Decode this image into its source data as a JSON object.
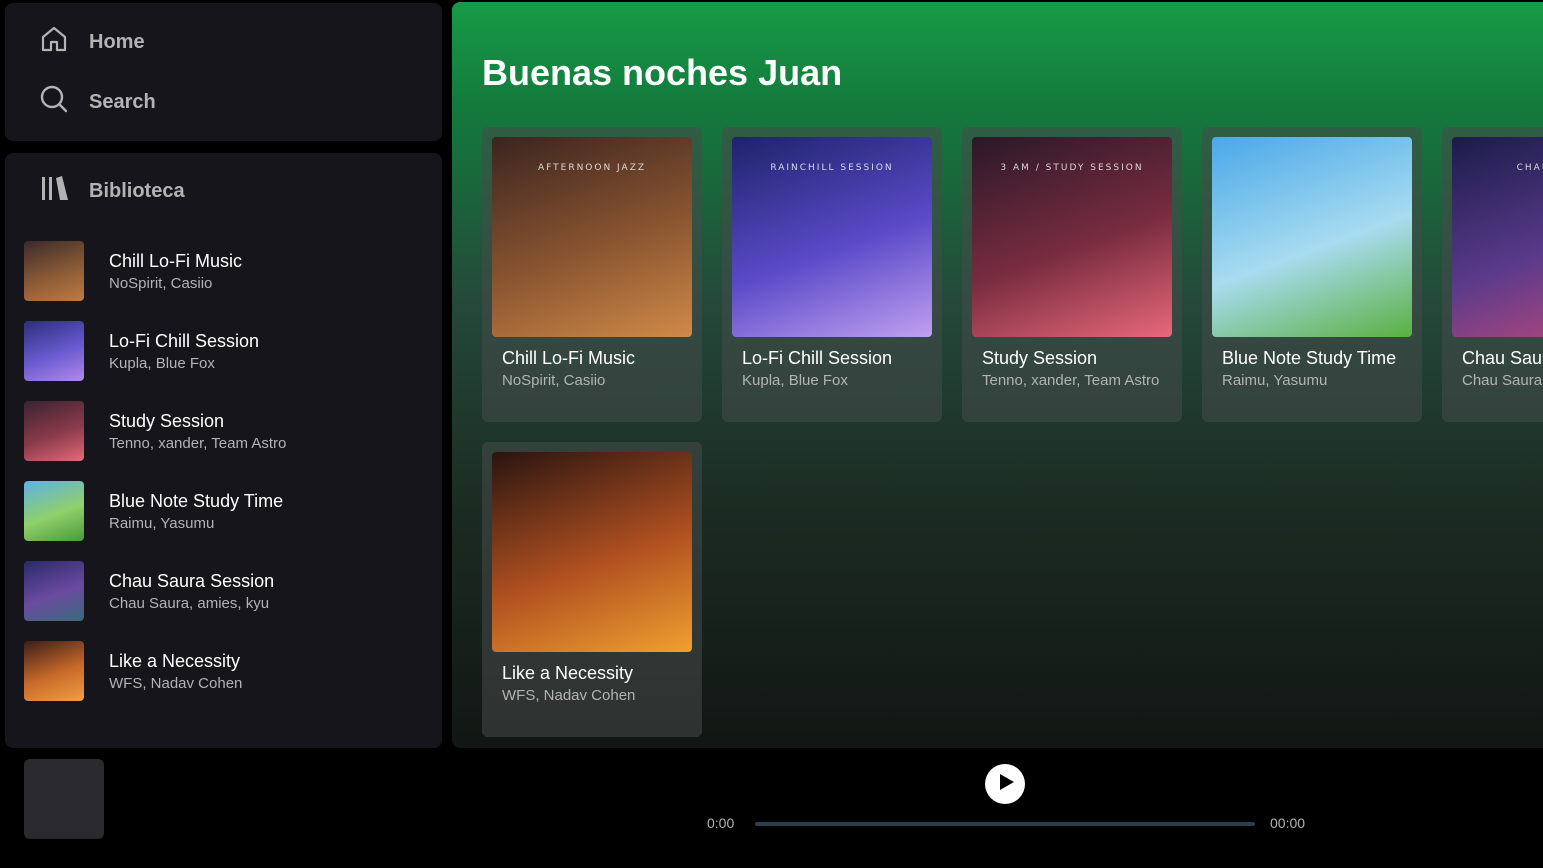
{
  "nav": {
    "home_label": "Home",
    "search_label": "Search"
  },
  "library": {
    "title": "Biblioteca",
    "items": [
      {
        "title": "Chill Lo-Fi Music",
        "artists": "NoSpirit, Casiio",
        "thumb_colors": [
          "#3b2a2a",
          "#8a5a36",
          "#c07a40"
        ]
      },
      {
        "title": "Lo-Fi Chill Session",
        "artists": "Kupla, Blue Fox",
        "thumb_colors": [
          "#2a2f7a",
          "#6a5ad0",
          "#b28ae8"
        ]
      },
      {
        "title": "Study Session",
        "artists": "Tenno, xander, Team Astro",
        "thumb_colors": [
          "#3a2230",
          "#8a3a4a",
          "#e56a7a"
        ]
      },
      {
        "title": "Blue Note Study Time",
        "artists": "Raimu, Yasumu",
        "thumb_colors": [
          "#5fb0e8",
          "#8fd06a",
          "#4a9a3a"
        ]
      },
      {
        "title": "Chau Saura Session",
        "artists": "Chau Saura, amies, kyu",
        "thumb_colors": [
          "#2a2a6a",
          "#6a4aa0",
          "#3a6a7a"
        ]
      },
      {
        "title": "Like a Necessity",
        "artists": "WFS, Nadav Cohen",
        "thumb_colors": [
          "#3a1e18",
          "#c86a2a",
          "#f0a040"
        ]
      }
    ]
  },
  "main": {
    "greeting": "Buenas noches Juan",
    "cards": [
      {
        "title": "Chill Lo-Fi Music",
        "artists": "NoSpirit, Casiio",
        "art_label": "AFTERNOON JAZZ",
        "art_colors": [
          "#3b2420",
          "#8a5530",
          "#d08a48"
        ]
      },
      {
        "title": "Lo-Fi Chill Session",
        "artists": "Kupla, Blue Fox",
        "art_label": "RAINCHILL SESSION",
        "art_colors": [
          "#1e236a",
          "#5a4ac8",
          "#c0a0f0"
        ]
      },
      {
        "title": "Study Session",
        "artists": "Tenno, xander, Team Astro",
        "art_label": "3 AM / STUDY SESSION",
        "art_colors": [
          "#2a1828",
          "#7a2c40",
          "#e8687a"
        ]
      },
      {
        "title": "Blue Note Study Time",
        "artists": "Raimu, Yasumu",
        "art_label": "",
        "art_colors": [
          "#4aa8e8",
          "#a8dcf0",
          "#5ab040"
        ]
      },
      {
        "title": "Chau Saura Session",
        "artists": "Chau Saura, amies, kyu",
        "art_label": "CHAU SARA",
        "art_colors": [
          "#1a1c4a",
          "#5a3a8a",
          "#c04a7a"
        ]
      },
      {
        "title": "Like a Necessity",
        "artists": "WFS, Nadav Cohen",
        "art_label": "",
        "art_colors": [
          "#2a1410",
          "#b05020",
          "#f0a030"
        ]
      }
    ]
  },
  "player": {
    "current_time": "0:00",
    "total_time": "00:00",
    "progress": 0
  }
}
